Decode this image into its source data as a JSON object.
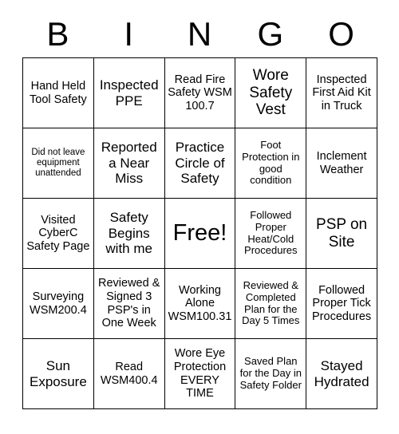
{
  "card": {
    "title_letters": [
      "B",
      "I",
      "N",
      "G",
      "O"
    ],
    "free_space_label": "Free!",
    "rows": [
      [
        {
          "text": "Hand Held Tool Safety",
          "size": "m"
        },
        {
          "text": "Inspected PPE",
          "size": "l"
        },
        {
          "text": "Read Fire Safety WSM 100.7",
          "size": "m"
        },
        {
          "text": "Wore Safety Vest",
          "size": "xl"
        },
        {
          "text": "Inspected First Aid Kit in Truck",
          "size": "m"
        }
      ],
      [
        {
          "text": "Did not leave equipment unattended",
          "size": "xs"
        },
        {
          "text": "Reported a Near Miss",
          "size": "l"
        },
        {
          "text": "Practice Circle of Safety",
          "size": "l"
        },
        {
          "text": "Foot Protection in good condition",
          "size": "s"
        },
        {
          "text": "Inclement Weather",
          "size": "m"
        }
      ],
      [
        {
          "text": "Visited CyberC Safety Page",
          "size": "m"
        },
        {
          "text": "Safety Begins with me",
          "size": "l"
        },
        {
          "text": "Free!",
          "size": "xxl"
        },
        {
          "text": "Followed Proper Heat/Cold Procedures",
          "size": "s"
        },
        {
          "text": "PSP on Site",
          "size": "xl"
        }
      ],
      [
        {
          "text": "Surveying WSM200.4",
          "size": "m"
        },
        {
          "text": "Reviewed & Signed 3 PSP's in One Week",
          "size": "m"
        },
        {
          "text": "Working Alone WSM100.31",
          "size": "m"
        },
        {
          "text": "Reviewed & Completed Plan for the Day 5 Times",
          "size": "s"
        },
        {
          "text": "Followed Proper Tick Procedures",
          "size": "m"
        }
      ],
      [
        {
          "text": "Sun Exposure",
          "size": "l"
        },
        {
          "text": "Read WSM400.4",
          "size": "m"
        },
        {
          "text": "Wore Eye Protection EVERY TIME",
          "size": "m"
        },
        {
          "text": "Saved Plan for the Day in Safety Folder",
          "size": "s"
        },
        {
          "text": "Stayed Hydrated",
          "size": "l"
        }
      ]
    ]
  },
  "colors": {
    "border": "#000000",
    "text": "#000000",
    "background": "#ffffff"
  }
}
